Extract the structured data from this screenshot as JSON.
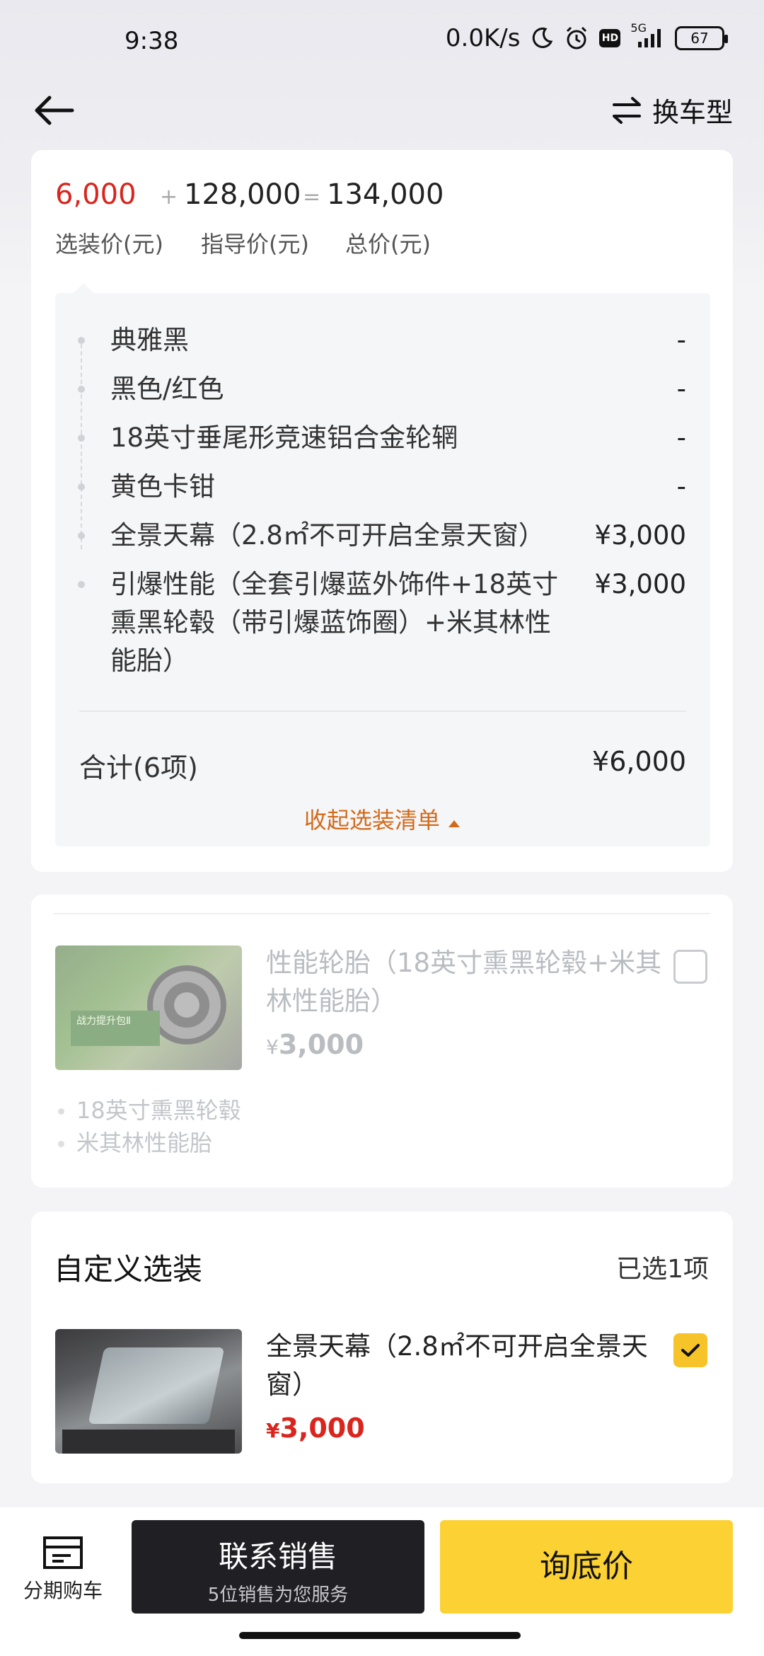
{
  "status_bar": {
    "time": "9:38",
    "net_speed": "0.0K/s",
    "hd_label": "HD",
    "signal_label": "5G",
    "battery": "67"
  },
  "header": {
    "switch_label": "换车型"
  },
  "price_summary": {
    "optional_price": "6,000",
    "plus": "+",
    "guide_price": "128,000",
    "equals": "=",
    "total_price": "134,000",
    "optional_label": "选装价(元)",
    "guide_label": "指导价(元)",
    "total_label": "总价(元)"
  },
  "options": {
    "items": [
      {
        "name": "典雅黑",
        "price": "-"
      },
      {
        "name": "黑色/红色",
        "price": "-"
      },
      {
        "name": "18英寸垂尾形竞速铝合金轮辋",
        "price": "-"
      },
      {
        "name": "黄色卡钳",
        "price": "-"
      },
      {
        "name": "全景天幕（2.8㎡不可开启全景天窗）",
        "price": "¥3,000"
      },
      {
        "name": " 引爆性能（全套引爆蓝外饰件+18英寸熏黑轮毂（带引爆蓝饰圈）+米其林性能胎）",
        "price": "¥3,000"
      }
    ],
    "sum_label": "合计(6项)",
    "sum_value": "¥6,000",
    "collapse_label": "收起选装清单"
  },
  "package": {
    "title": "性能轮胎（18英寸熏黑轮毂+米其林性能胎）",
    "price_symbol": "¥",
    "price": "3,000",
    "image_text": "战力提升包Ⅱ",
    "features": [
      "18英寸熏黑轮毂",
      "米其林性能胎"
    ],
    "checked": false
  },
  "custom": {
    "title": "自定义选装",
    "count": "已选1项",
    "item_name": "全景天幕（2.8㎡不可开启全景天窗）",
    "price_symbol": "¥",
    "price": "3,000",
    "checked": true
  },
  "bottom_bar": {
    "installment_label": "分期购车",
    "contact_label": "联系销售",
    "contact_sub": "5位销售为您服务",
    "floor_price_label": "询底价"
  },
  "colors": {
    "accent_red": "#d9251d",
    "accent_yellow": "#fbd133",
    "collapse_orange": "#d36a1a",
    "dark_button": "#1f1f24"
  }
}
